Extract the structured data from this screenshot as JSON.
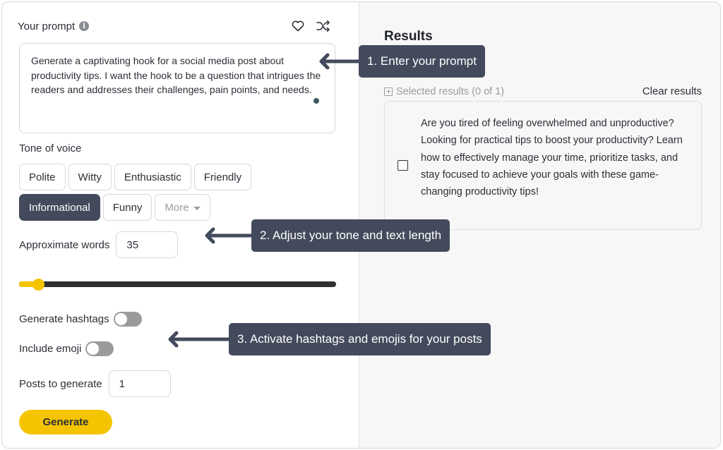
{
  "prompt": {
    "label": "Your prompt",
    "info_icon": "info-icon",
    "favorite_icon": "heart-icon",
    "shuffle_icon": "shuffle-icon",
    "text": "Generate a captivating hook for a social media post about productivity tips. I want the hook to be a question that intrigues the readers and addresses their challenges, pain points, and needs."
  },
  "tone": {
    "label": "Tone of voice",
    "options": [
      "Polite",
      "Witty",
      "Enthusiastic",
      "Friendly",
      "Informational",
      "Funny"
    ],
    "selected": "Informational",
    "more_label": "More"
  },
  "words": {
    "label": "Approximate words",
    "value": "35",
    "slider_fraction": 0.06
  },
  "hashtags": {
    "label": "Generate hashtags",
    "enabled": false
  },
  "emoji": {
    "label": "Include emoji",
    "enabled": false
  },
  "posts": {
    "label": "Posts to generate",
    "value": "1"
  },
  "generate_label": "Generate",
  "results": {
    "title": "Results",
    "selected_text": "Selected results (0 of 1)",
    "clear_label": "Clear results",
    "items": [
      {
        "text": "Are you tired of feeling overwhelmed and unproductive? Looking for practical tips to boost your productivity? Learn how to effectively manage your time, prioritize tasks, and stay focused to achieve your goals with these game-changing productivity tips!",
        "checked": false
      }
    ]
  },
  "callouts": {
    "step1": "1. Enter your prompt",
    "step2": "2. Adjust your tone and text length",
    "step3": "3. Activate hashtags and emojis for your posts"
  },
  "colors": {
    "accent": "#f5c400",
    "dark": "#434a5c"
  }
}
